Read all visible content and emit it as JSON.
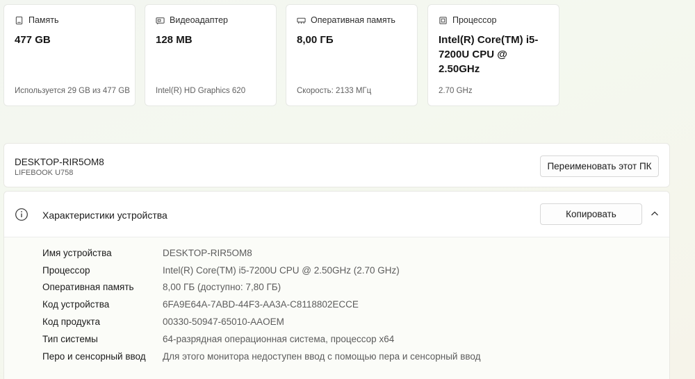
{
  "cards": [
    {
      "icon": "storage-icon",
      "title": "Память",
      "value": "477 GB",
      "sub": "Используется 29 GB из 477 GB"
    },
    {
      "icon": "graphics-icon",
      "title": "Видеоадаптер",
      "value": "128 MB",
      "sub": "Intel(R) HD Graphics 620"
    },
    {
      "icon": "ram-icon",
      "title": "Оперативная память",
      "value": "8,00 ГБ",
      "sub": "Скорость: 2133 МГц"
    },
    {
      "icon": "processor-icon",
      "title": "Процессор",
      "value": "Intel(R) Core(TM) i5-7200U CPU @ 2.50GHz",
      "sub": "2.70 GHz"
    }
  ],
  "device": {
    "name": "DESKTOP-RIR5OM8",
    "model": "LIFEBOOK U758",
    "rename_label": "Переименовать этот ПК"
  },
  "specs": {
    "title": "Характеристики устройства",
    "copy_label": "Копировать",
    "rows": [
      {
        "label": "Имя устройства",
        "value": "DESKTOP-RIR5OM8"
      },
      {
        "label": "Процессор",
        "value": "Intel(R) Core(TM) i5-7200U CPU @ 2.50GHz (2.70 GHz)"
      },
      {
        "label": "Оперативная память",
        "value": "8,00 ГБ (доступно: 7,80 ГБ)"
      },
      {
        "label": "Код устройства",
        "value": "6FA9E64A-7ABD-44F3-AA3A-C8118802ECCE"
      },
      {
        "label": "Код продукта",
        "value": "00330-50947-65010-AAOEM"
      },
      {
        "label": "Тип системы",
        "value": "64-разрядная операционная система, процессор x64"
      },
      {
        "label": "Перо и сенсорный ввод",
        "value": "Для этого монитора недоступен ввод с помощью пера и сенсорный ввод"
      }
    ]
  }
}
